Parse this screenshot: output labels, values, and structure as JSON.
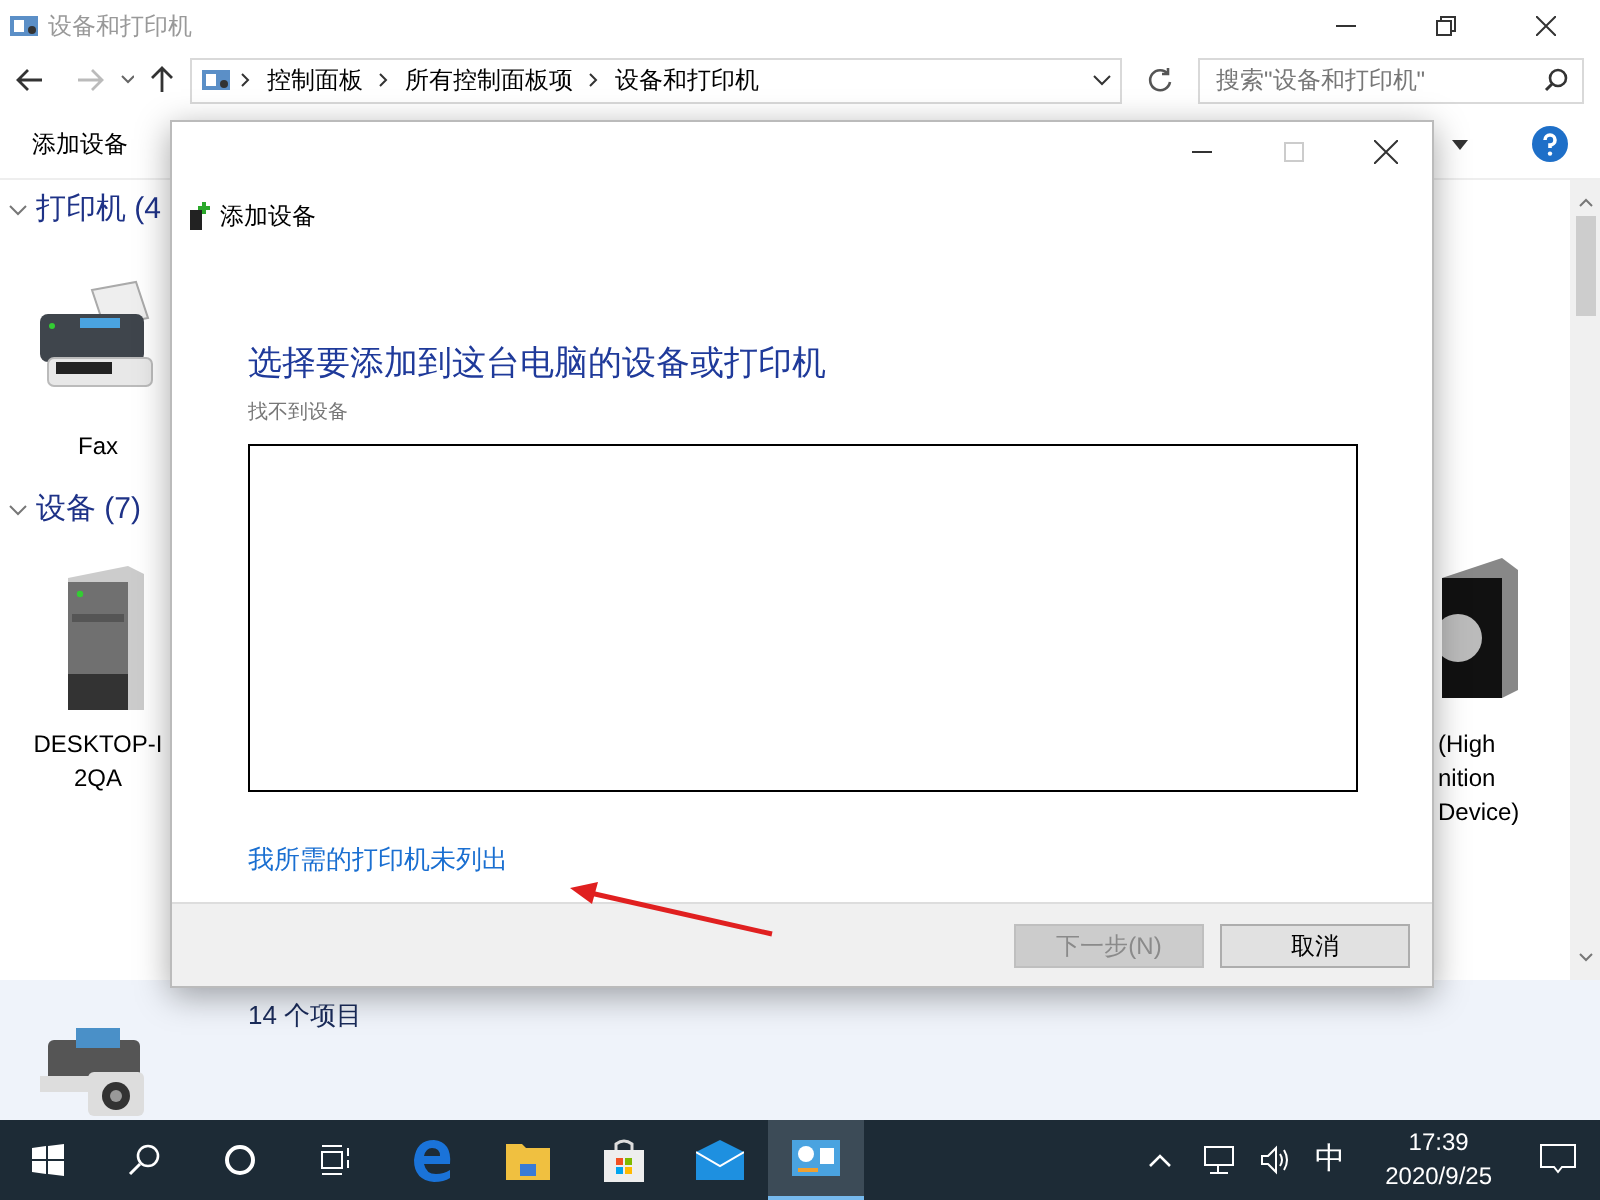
{
  "window": {
    "title": "设备和打印机"
  },
  "address_bar": {
    "breadcrumbs": [
      "控制面板",
      "所有控制面板项",
      "设备和打印机"
    ]
  },
  "search": {
    "placeholder": "搜索\"设备和打印机\""
  },
  "toolbar": {
    "buttons": [
      "添加设备"
    ]
  },
  "groups": [
    {
      "label": "打印机 (4",
      "expanded": true,
      "items": [
        {
          "kind": "fax",
          "lines": [
            "Fax"
          ]
        }
      ]
    },
    {
      "label": "设备 (7)",
      "expanded": true,
      "items": [
        {
          "kind": "computer",
          "lines": [
            "DESKTOP-I",
            "2QA"
          ]
        },
        {
          "kind": "speaker",
          "lines": [
            "(High",
            "nition",
            "Device)"
          ]
        }
      ]
    }
  ],
  "status_bar": {
    "text": "14 个项目"
  },
  "dialog": {
    "title": "添加设备",
    "heading": "选择要添加到这台电脑的设备或打印机",
    "status": "找不到设备",
    "link": "我所需的打印机未列出",
    "buttons": [
      {
        "label": "下一步(N)",
        "disabled": true
      },
      {
        "label": "取消",
        "disabled": false
      }
    ]
  },
  "taskbar": {
    "apps": [
      {
        "kind": "edge",
        "selected": false
      },
      {
        "kind": "folder",
        "selected": false
      },
      {
        "kind": "store",
        "selected": false
      },
      {
        "kind": "mail",
        "selected": false
      },
      {
        "kind": "control",
        "selected": true
      }
    ],
    "ime": "中",
    "time": "17:39",
    "date": "2020/9/25"
  }
}
